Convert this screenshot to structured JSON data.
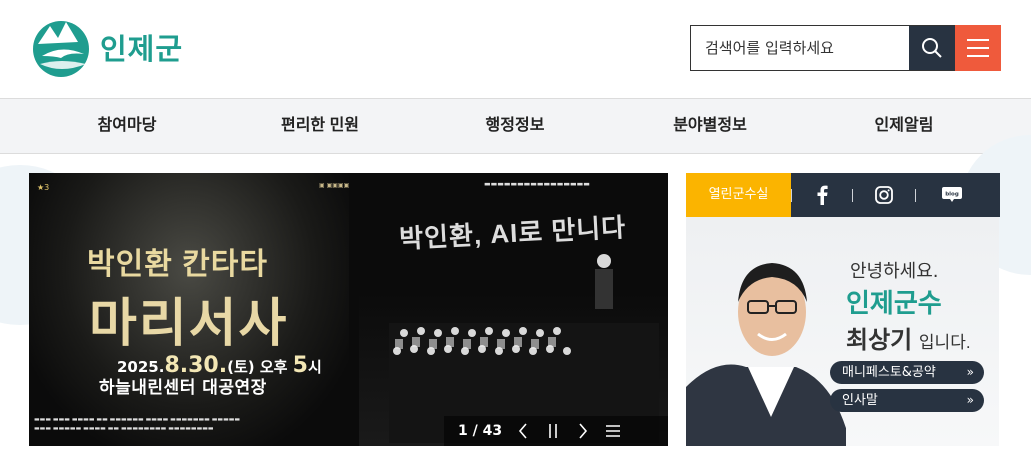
{
  "header": {
    "logo_text": "인제군",
    "search": {
      "placeholder": "검색어를 입력하세요"
    }
  },
  "nav": {
    "items": [
      {
        "label": "참여마당"
      },
      {
        "label": "편리한 민원"
      },
      {
        "label": "행정정보"
      },
      {
        "label": "분야별정보"
      },
      {
        "label": "인제알림"
      }
    ]
  },
  "banner": {
    "title_line1": "박인환 칸타타",
    "title_line2": "마리서사",
    "slogan": "박인환, AI로 만니다",
    "date_prefix": "2025.",
    "date_main": "8.30.",
    "date_suffix": "(토) 오후",
    "time": "5",
    "time_unit": "시",
    "venue": "하늘내린센터 대공연장",
    "slide_counter": "1 / 43"
  },
  "side": {
    "tab_label": "열린군수실",
    "icons": [
      "facebook-icon",
      "instagram-icon",
      "blog-icon"
    ],
    "blog_text": "blog",
    "greeting_line1": "안녕하세요.",
    "greeting_line2": "인제군수",
    "mayor_name": "최상기",
    "greeting_suffix": "입니다.",
    "buttons": [
      {
        "label": "매니페스토&공약"
      },
      {
        "label": "인사말"
      }
    ]
  },
  "colors": {
    "brand_teal": "#1f9d8f",
    "accent_orange": "#ef5a3c",
    "dark_navy": "#283341",
    "tab_yellow": "#fbb400"
  }
}
